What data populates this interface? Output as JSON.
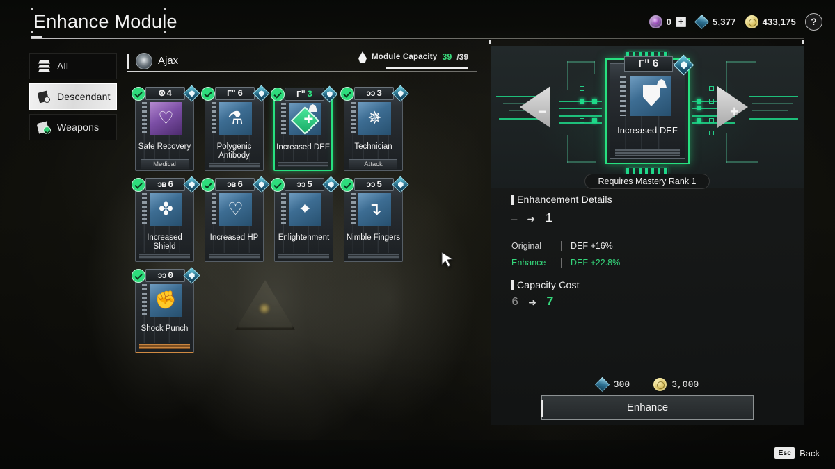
{
  "header": {
    "title": "Enhance Module",
    "currencies": [
      {
        "icon": "purple-gem-icon",
        "value": "0",
        "has_plus": true
      },
      {
        "icon": "blue-crystal-icon",
        "value": "5,377",
        "has_plus": false
      },
      {
        "icon": "gold-coin-icon",
        "value": "433,175",
        "has_plus": false
      }
    ],
    "help_label": "?"
  },
  "sidebar": {
    "items": [
      {
        "label": "All",
        "icon": "layers-icon",
        "active": false
      },
      {
        "label": "Descendant",
        "icon": "card-descendant-icon",
        "active": true
      },
      {
        "label": "Weapons",
        "icon": "card-weapons-icon",
        "active": false
      }
    ]
  },
  "list_header": {
    "character": "Ajax",
    "capacity_label": "Module Capacity",
    "capacity_current": "39",
    "capacity_max": "/39"
  },
  "modules": [
    {
      "name": "Safe Recovery",
      "socket": "⨷",
      "level": "4",
      "tag": "Medical",
      "art": "purple",
      "glyph": "♡",
      "selected": false,
      "orange_foot": false
    },
    {
      "name": "Polygenic Antibody",
      "socket": "Γʺ",
      "level": "6",
      "tag": "",
      "art": "blue",
      "glyph": "⚗",
      "selected": false,
      "orange_foot": false
    },
    {
      "name": "Increased DEF",
      "socket": "Γʺ",
      "level": "3",
      "tag": "",
      "art": "blue",
      "glyph": "",
      "selected": true,
      "orange_foot": false
    },
    {
      "name": "Technician",
      "socket": "ᴐᴐ",
      "level": "3",
      "tag": "Attack",
      "art": "blue",
      "glyph": "✵",
      "selected": false,
      "orange_foot": false
    },
    {
      "name": "Increased Shield",
      "socket": "ɔʙ",
      "level": "6",
      "tag": "",
      "art": "blue",
      "glyph": "✤",
      "selected": false,
      "orange_foot": false
    },
    {
      "name": "Increased HP",
      "socket": "ɔʙ",
      "level": "6",
      "tag": "",
      "art": "blue",
      "glyph": "♡",
      "selected": false,
      "orange_foot": false
    },
    {
      "name": "Enlightenment",
      "socket": "ᴐᴐ",
      "level": "5",
      "tag": "",
      "art": "blue",
      "glyph": "✦",
      "selected": false,
      "orange_foot": false
    },
    {
      "name": "Nimble Fingers",
      "socket": "ᴐᴐ",
      "level": "5",
      "tag": "",
      "art": "blue",
      "glyph": "↴",
      "selected": false,
      "orange_foot": false
    },
    {
      "name": "Shock Punch",
      "socket": "ᴐᴐ",
      "level": "0",
      "tag": "",
      "art": "blue",
      "glyph": "✊",
      "selected": false,
      "orange_foot": true
    }
  ],
  "detail": {
    "selected_module": {
      "name": "Increased DEF",
      "socket": "Γʺ",
      "level": "6"
    },
    "prev_label": "−",
    "next_label": "+",
    "mastery_requirement": "Requires Mastery Rank 1",
    "enhancement_details_title": "Enhancement Details",
    "level_from": "–",
    "level_arrow": "➜",
    "level_to": "1",
    "stats": [
      {
        "label": "Original",
        "value": "DEF +16%",
        "highlight": false
      },
      {
        "label": "Enhance",
        "value": "DEF +22.8%",
        "highlight": true
      }
    ],
    "capacity_cost_title": "Capacity Cost",
    "cost_from": "6",
    "cost_arrow": "➜",
    "cost_to": "7",
    "payment": [
      {
        "icon": "blue-crystal-icon",
        "value": "300"
      },
      {
        "icon": "gold-coin-icon",
        "value": "3,000"
      }
    ],
    "enhance_button": "Enhance"
  },
  "footer": {
    "esc_key": "Esc",
    "back_label": "Back"
  },
  "colors": {
    "accent_green": "#2ddc7b",
    "crystal_blue": "#3d8fb0",
    "gold": "#d9c264",
    "panel_bg": "#1a1c1c"
  }
}
